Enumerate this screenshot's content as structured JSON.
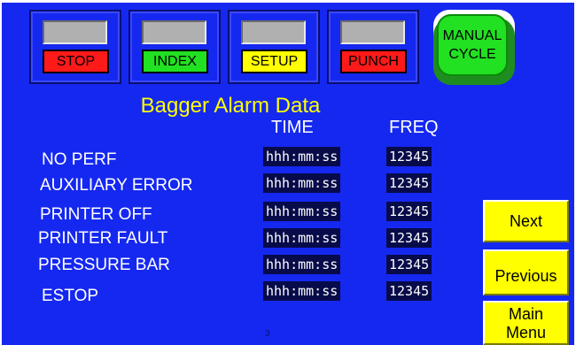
{
  "toolbar": {
    "buttons": [
      {
        "label": "STOP",
        "color": "#ff1a1a"
      },
      {
        "label": "INDEX",
        "color": "#22e022"
      },
      {
        "label": "SETUP",
        "color": "#ffff00"
      },
      {
        "label": "PUNCH",
        "color": "#ff1a1a"
      }
    ],
    "manual_cycle": {
      "line1": "MANUAL",
      "line2": "CYCLE",
      "color": "#22e022"
    }
  },
  "title": "Bagger Alarm Data",
  "columns": {
    "time": "TIME",
    "freq": "FREQ"
  },
  "rows": [
    {
      "label": "NO PERF",
      "time": "hhh:mm:ss",
      "freq": "12345"
    },
    {
      "label": "AUXILIARY ERROR",
      "time": "hhh:mm:ss",
      "freq": "12345"
    },
    {
      "label": "PRINTER OFF",
      "time": "hhh:mm:ss",
      "freq": "12345"
    },
    {
      "label": "PRINTER FAULT",
      "time": "hhh:mm:ss",
      "freq": "12345"
    },
    {
      "label": "PRESSURE BAR",
      "time": "hhh:mm:ss",
      "freq": "12345"
    },
    {
      "label": "ESTOP",
      "time": "hhh:mm:ss",
      "freq": "12345"
    }
  ],
  "nav": {
    "next": "Next",
    "previous": "Previous",
    "main_line1": "Main",
    "main_line2": "Menu"
  },
  "page_number": "3",
  "colors": {
    "background": "#1528f0",
    "title": "#ffff00",
    "value_box": "#070b4a",
    "nav_button": "#ffff00"
  }
}
